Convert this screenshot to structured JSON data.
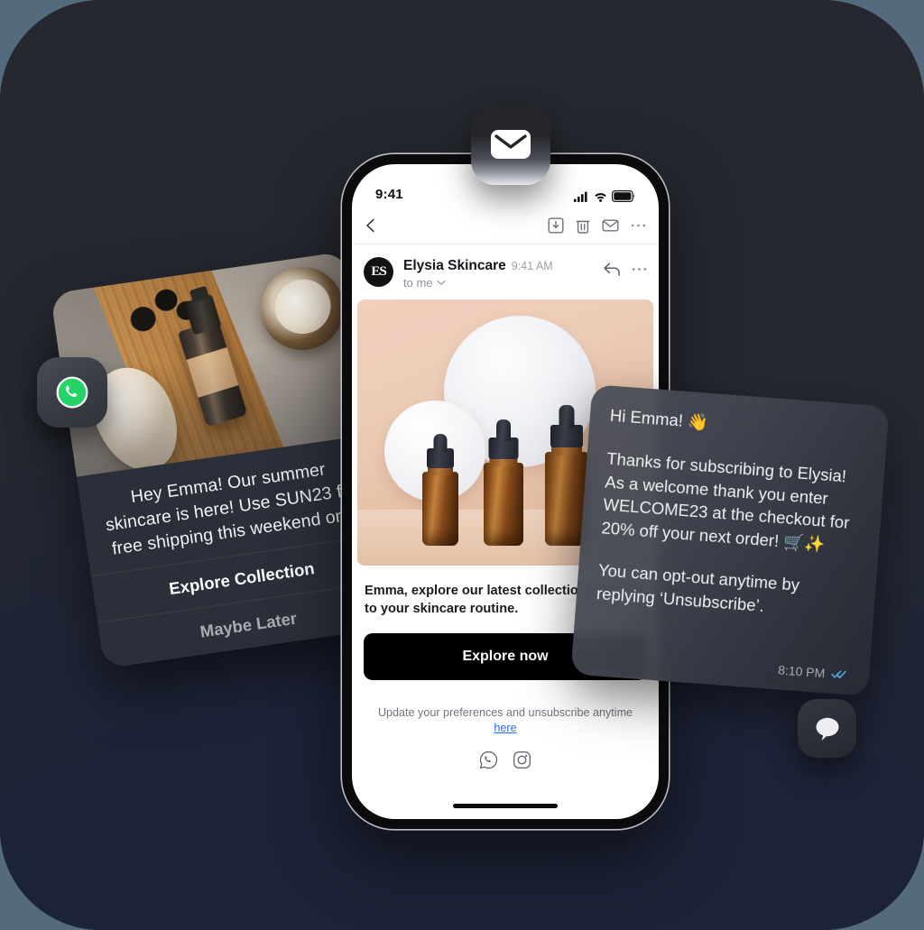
{
  "theme": {
    "outer_bg": "#546a7d",
    "panel_bg": "#262930",
    "panel_navy": "#1d2337",
    "accent_link": "#2a6df5",
    "whatsapp_green": "#25D366",
    "cta_bg": "#000000",
    "card_bg": "#2b2f39",
    "bubble_tint": "#484c56"
  },
  "app_icons": {
    "mail": {
      "name": "envelope-icon",
      "label": "Mail"
    },
    "whatsapp": {
      "name": "whatsapp-icon",
      "label": "WhatsApp"
    },
    "chat": {
      "name": "chat-bubble-icon",
      "label": "Chat"
    }
  },
  "push_notification": {
    "image_alt": "skincare spray bottle, soap bar and cream jar on wooden board",
    "message": "Hey Emma! Our summer skincare is here! Use SUN23 for free shipping this weekend only",
    "primary_action": "Explore Collection",
    "secondary_action": "Maybe Later",
    "app_badge_icon": "whatsapp-icon"
  },
  "phone": {
    "status_bar": {
      "time": "9:41",
      "icons": [
        "cellular-signal-icon",
        "wifi-icon",
        "battery-icon"
      ]
    },
    "home_indicator": true,
    "mail_app": {
      "toolbar": {
        "back_icon": "chevron-left-icon",
        "actions": [
          {
            "name": "archive-icon",
            "label": "Archive"
          },
          {
            "name": "trash-icon",
            "label": "Delete"
          },
          {
            "name": "envelope-icon",
            "label": "Mark unread"
          },
          {
            "name": "more-icon",
            "label": "More"
          }
        ]
      },
      "message_header": {
        "avatar_initials": "ES",
        "sender": "Elysia Skincare",
        "time": "9:41 AM",
        "recipient": "to me",
        "recipient_chevron": "chevron-down-icon",
        "actions": [
          {
            "name": "reply-icon",
            "label": "Reply"
          },
          {
            "name": "more-icon",
            "label": "More"
          }
        ]
      },
      "hero_image_alt": "three amber glass dropper bottles in front of white circles on a peach background",
      "body_copy": "Emma, explore our latest collection tailored to your skincare routine.",
      "cta_label": "Explore now",
      "footer": {
        "text_before": "Update your preferences and unsubscribe anytime ",
        "link_label": "here",
        "social": [
          {
            "name": "whatsapp-icon",
            "label": "WhatsApp"
          },
          {
            "name": "instagram-icon",
            "label": "Instagram"
          }
        ]
      }
    }
  },
  "whatsapp_message": {
    "greeting": "Hi Emma! 👋",
    "body": "Thanks for subscribing to Elysia! As a welcome thank you enter WELCOME23 at the checkout for 20% off your next order! 🛒✨",
    "opt_out": "You can opt-out anytime by replying ‘Unsubscribe’.",
    "time": "8:10 PM",
    "read_status_icon": "double-check-icon"
  }
}
